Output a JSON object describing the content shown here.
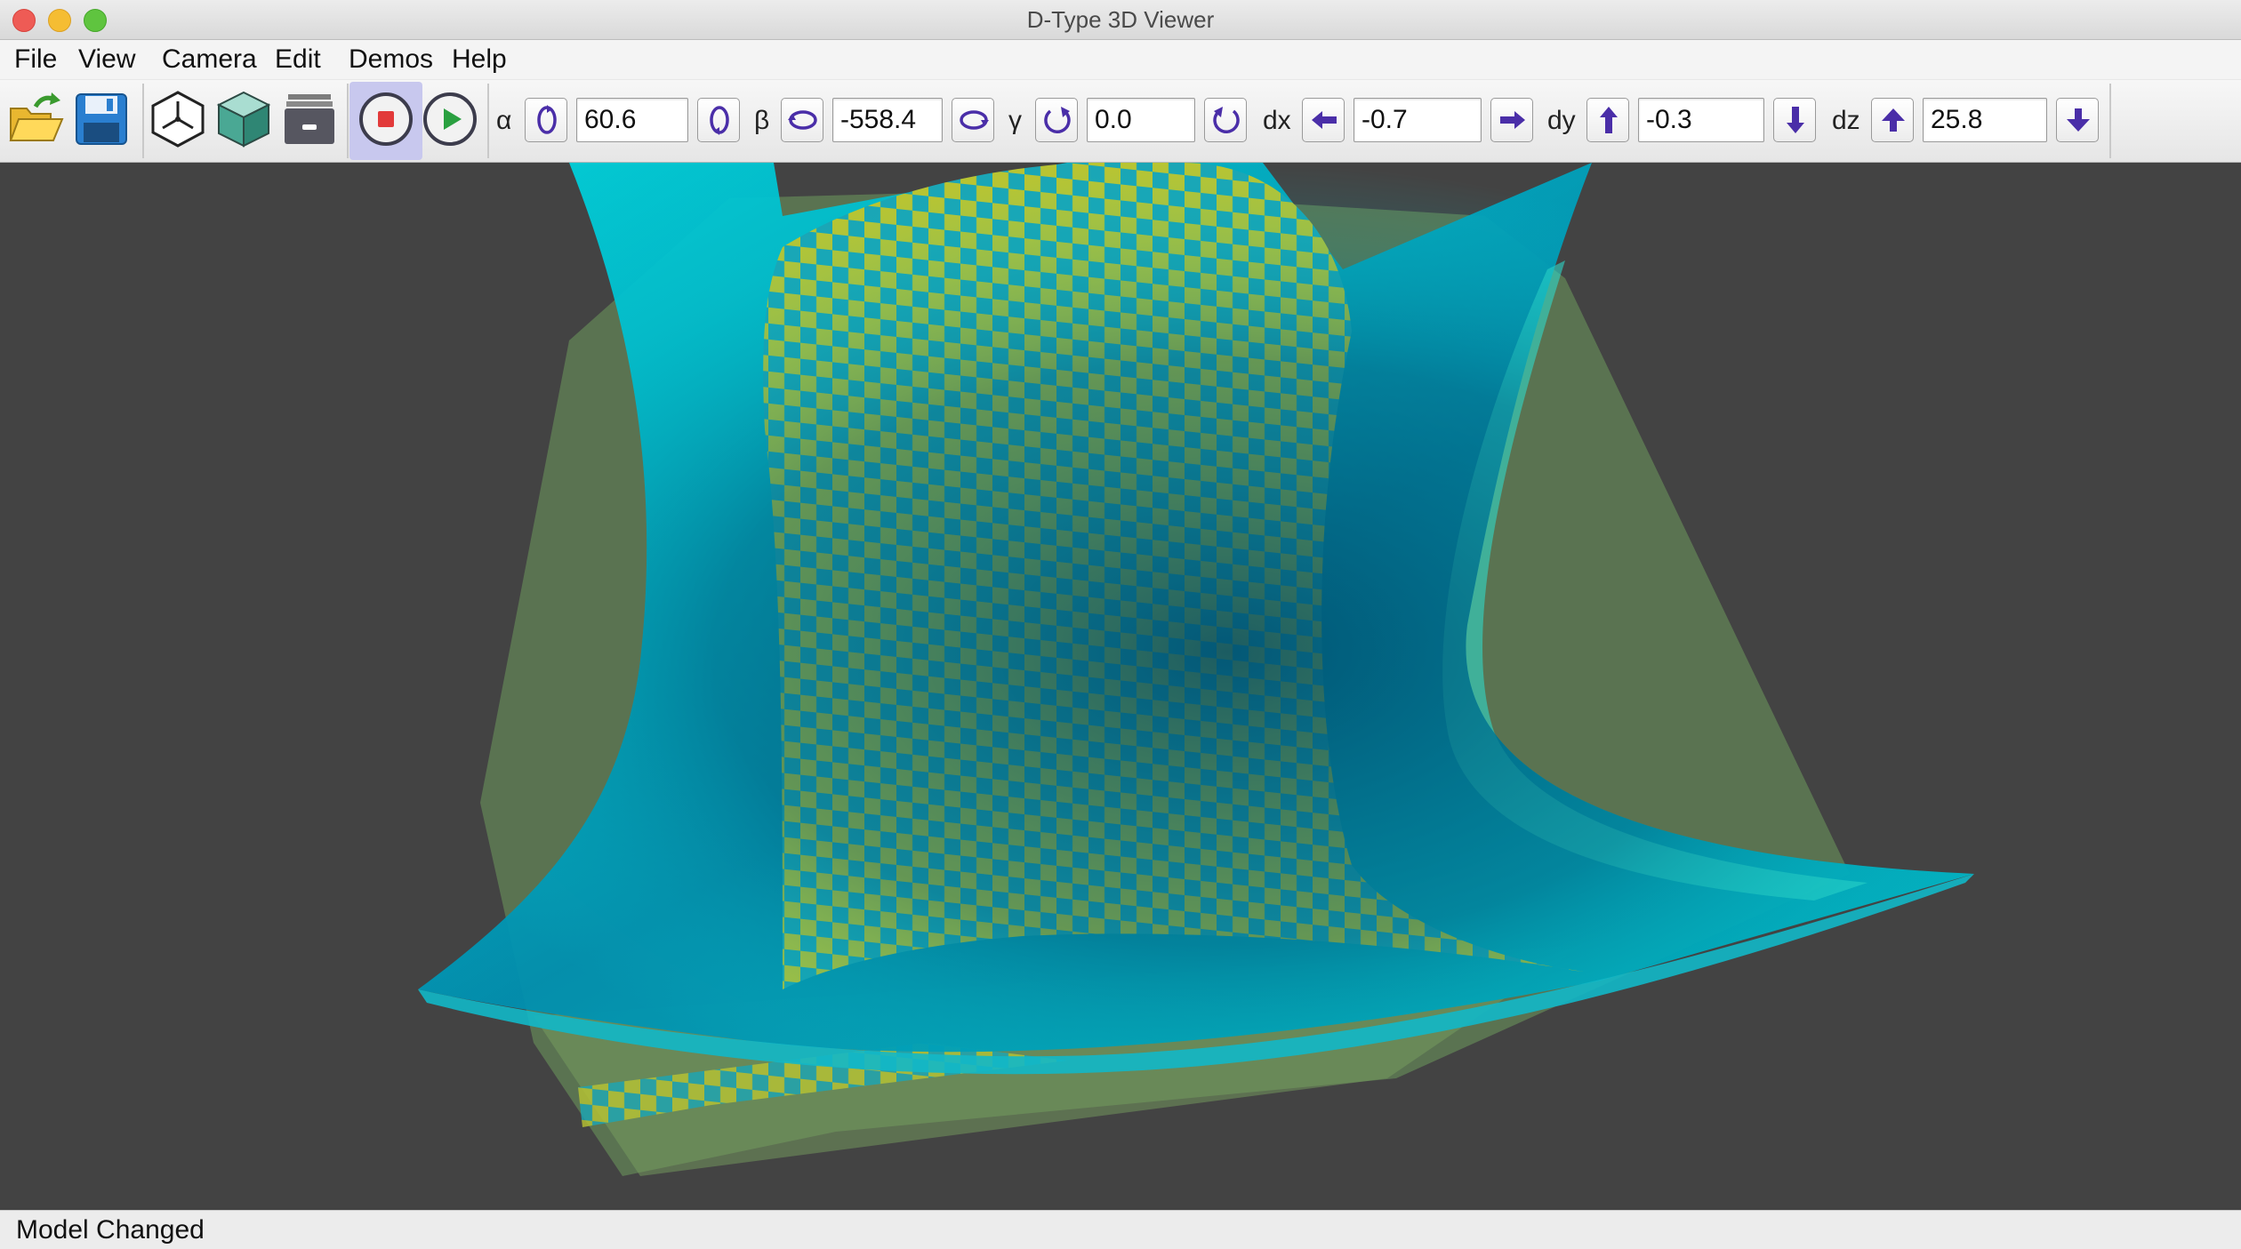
{
  "window": {
    "title": "D-Type 3D Viewer"
  },
  "menu": {
    "items": [
      "File",
      "View",
      "Camera",
      "Edit",
      "Demos",
      "Help"
    ]
  },
  "toolbar": {
    "icons": [
      "open-folder-icon",
      "save-disk-icon",
      "axes-cube-icon",
      "solid-cube-icon",
      "archive-box-icon",
      "stop-icon",
      "play-icon"
    ],
    "active_icon": "stop-icon"
  },
  "camera": {
    "alpha": {
      "label": "α",
      "value": "60.6"
    },
    "beta": {
      "label": "β",
      "value": "-558.4"
    },
    "gamma": {
      "label": "γ",
      "value": "0.0"
    },
    "dx": {
      "label": "dx",
      "value": "-0.7"
    },
    "dy": {
      "label": "dy",
      "value": "-0.3"
    },
    "dz": {
      "label": "dz",
      "value": "25.8"
    }
  },
  "scene": {
    "background": "#434343",
    "surface_color": "#00c8d0",
    "checker_colors": [
      "#1aa6b6",
      "#b8c432"
    ],
    "ghost_color": "#6d9a5c"
  },
  "status": {
    "text": "Model Changed"
  }
}
